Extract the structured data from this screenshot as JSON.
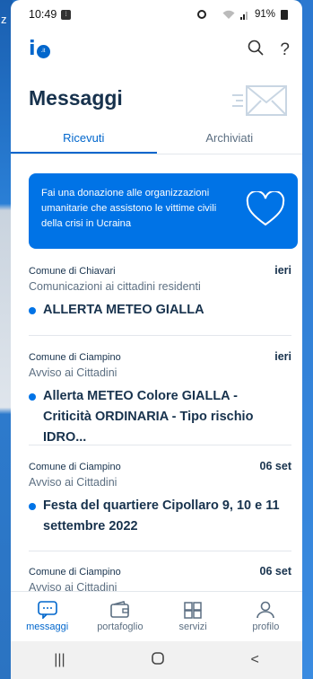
{
  "status_bar": {
    "time": "10:49",
    "battery": "91%"
  },
  "header": {
    "app_logo": "io",
    "page_title": "Messaggi"
  },
  "tabs": [
    {
      "label": "Ricevuti",
      "active": true
    },
    {
      "label": "Archiviati",
      "active": false
    }
  ],
  "banner": {
    "text": "Fai una donazione alle organizzazioni umanitarie che assistono le vittime civili della crisi in Ucraina"
  },
  "messages": [
    {
      "sender": "Comune di Chiavari",
      "date": "ieri",
      "service": "Comunicazioni ai cittadini residenti",
      "subject": "ALLERTA METEO GIALLA"
    },
    {
      "sender": "Comune di Ciampino",
      "date": "ieri",
      "service": "Avviso ai Cittadini",
      "subject_line1": "Allerta METEO Colore GIALLA -",
      "subject_line2": "Criticità ORDINARIA - Tipo rischio IDRO..."
    },
    {
      "sender": "Comune di Ciampino",
      "date": "06 set",
      "service": "Avviso ai Cittadini",
      "subject_line1": "Festa del quartiere Cipollaro 9, 10 e 11",
      "subject_line2": "settembre 2022"
    },
    {
      "sender": "Comune di Ciampino",
      "date": "06 set",
      "service": "Avviso ai Cittadini"
    }
  ],
  "bottom_nav": [
    {
      "label": "messaggi",
      "icon": "chat-icon",
      "active": true
    },
    {
      "label": "portafoglio",
      "icon": "wallet-icon",
      "active": false
    },
    {
      "label": "servizi",
      "icon": "services-icon",
      "active": false
    },
    {
      "label": "profilo",
      "icon": "user-icon",
      "active": false
    }
  ],
  "colors": {
    "accent": "#0066cc",
    "banner": "#0073e6",
    "text_dark": "#17324d",
    "text_muted": "#5c6f82"
  }
}
